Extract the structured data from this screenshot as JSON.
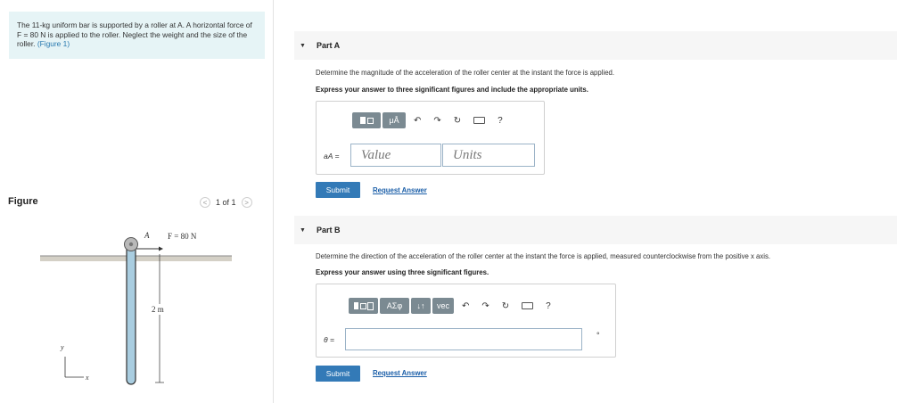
{
  "problem": {
    "text_before": "The 11-kg uniform bar is supported by a roller at A. A horizontal force of F = 80 N is applied to the roller. Neglect the weight and the size of the roller.",
    "figure_link": "(Figure 1)"
  },
  "figure_panel": {
    "title": "Figure",
    "pager": "1 of 1",
    "prev": "<",
    "next": ">",
    "labels": {
      "A": "A",
      "force": "F = 80 N",
      "length": "2 m",
      "y": "y",
      "x": "x"
    }
  },
  "partA": {
    "title": "Part A",
    "question": "Determine the magnitude of the acceleration of the roller center at the instant the force is applied.",
    "instruction": "Express your answer to three significant figures and include the appropriate units.",
    "var_label": "aA =",
    "value_placeholder": "Value",
    "units_placeholder": "Units",
    "toolbar": {
      "mu": "μÅ",
      "help": "?"
    },
    "submit": "Submit",
    "request": "Request Answer"
  },
  "partB": {
    "title": "Part B",
    "question": "Determine the direction of the acceleration of the roller center at the instant the force is applied, measured counterclockwise from the positive x axis.",
    "instruction": "Express your answer using three significant figures.",
    "var_label": "θ =",
    "answer_value": "",
    "unit_mark": "°",
    "toolbar": {
      "greek": "ΑΣφ",
      "arrows": "↓↑",
      "vec": "vec",
      "help": "?"
    },
    "submit": "Submit",
    "request": "Request Answer"
  }
}
